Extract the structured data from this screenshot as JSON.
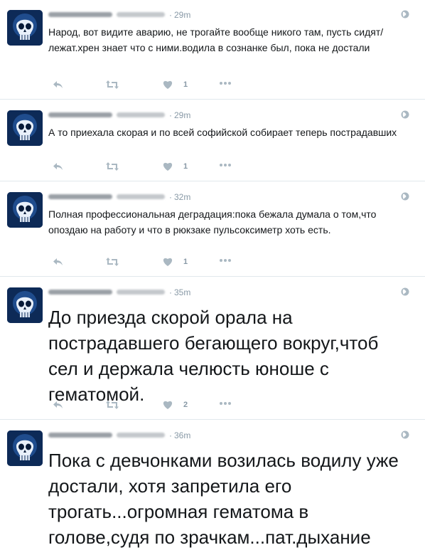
{
  "tweets": [
    {
      "time": "29m",
      "size": "small",
      "text": "Народ, вот видите аварию, не трогайте вообще никого там, пусть сидят/лежат.хрен знает что с ними.водила в сознанке был, пока не достали",
      "likes": "1"
    },
    {
      "time": "29m",
      "size": "small",
      "text": "А то приехала скорая и по всей софийской собирает теперь пострадавших",
      "likes": "1"
    },
    {
      "time": "32m",
      "size": "small",
      "text": "Полная профессиональная деградация:пока бежала думала о том,что опоздаю на работу и что в рюкзаке пульсоксиметр хоть есть.",
      "likes": "1"
    },
    {
      "time": "35m",
      "size": "large",
      "text": "До приезда скорой орала на пострадавшего бегающего вокруг,чтоб сел и держала челюсть юноше с гематомой.",
      "likes": "2"
    },
    {
      "time": "36m",
      "size": "large",
      "text": "Пока с девчонками возилась водилу уже достали, хотя запретила его трогать...огромная гематома в голове,судя по зрачкам...пат.дыхание",
      "likes": ""
    }
  ],
  "icons": {
    "avatar": "skull-avatar",
    "globe": "globe-icon",
    "reply": "reply-icon",
    "retweet": "retweet-icon",
    "like": "heart-icon",
    "more": "more-icon"
  },
  "colors": {
    "text": "#14171a",
    "muted": "#8899a6",
    "border": "#e1e8ed",
    "avatar_bg": "#0d2a57"
  }
}
